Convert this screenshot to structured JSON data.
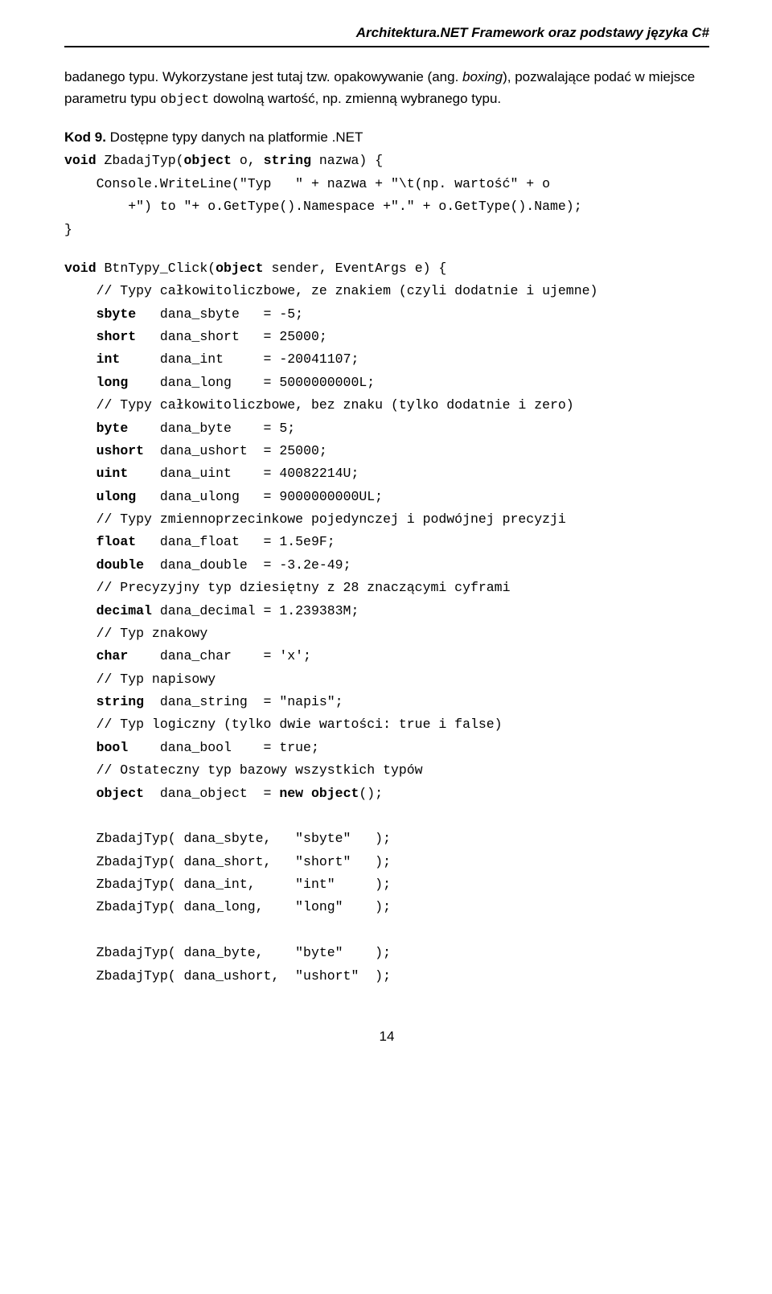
{
  "header": "Architektura.NET Framework oraz podstawy języka C#",
  "para1_a": "badanego typu. Wykorzystane jest tutaj tzw. opakowywanie (ang. ",
  "para1_b": "boxing",
  "para1_c": "), pozwalające podać w miejsce parametru typu ",
  "para1_d": "object",
  "para1_e": " dowolną wartość, np. zmienną wybranego typu.",
  "kod_label_a": "Kod 9.",
  "kod_label_b": " Dostępne typy danych na platformie .NET",
  "lines": {
    "l1a": "void",
    "l1b": " ZbadajTyp(",
    "l1c": "object",
    "l1d": " o, ",
    "l1e": "string",
    "l1f": " nazwa) {",
    "l2": "    Console.WriteLine(\"Typ   \" + nazwa + \"\\t(np. wartość\" + o",
    "l3": "        +\") to \"+ o.GetType().Namespace +\".\" + o.GetType().Name);",
    "l4": "}",
    "l5a": "void",
    "l5b": " BtnTypy_Click(",
    "l5c": "object",
    "l5d": " sender, EventArgs e) {",
    "l6": "    // Typy całkowitoliczbowe, ze znakiem (czyli dodatnie i ujemne)",
    "l7a": "    ",
    "l7b": "sbyte",
    "l7c": "   dana_sbyte   = -5;",
    "l8a": "    ",
    "l8b": "short",
    "l8c": "   dana_short   = 25000;",
    "l9a": "    ",
    "l9b": "int",
    "l9c": "     dana_int     = -20041107;",
    "l10a": "    ",
    "l10b": "long",
    "l10c": "    dana_long    = 5000000000L;",
    "l11": "    // Typy całkowitoliczbowe, bez znaku (tylko dodatnie i zero)",
    "l12a": "    ",
    "l12b": "byte",
    "l12c": "    dana_byte    = 5;",
    "l13a": "    ",
    "l13b": "ushort",
    "l13c": "  dana_ushort  = 25000;",
    "l14a": "    ",
    "l14b": "uint",
    "l14c": "    dana_uint    = 40082214U;",
    "l15a": "    ",
    "l15b": "ulong",
    "l15c": "   dana_ulong   = 9000000000UL;",
    "l16": "    // Typy zmiennoprzecinkowe pojedynczej i podwójnej precyzji",
    "l17a": "    ",
    "l17b": "float",
    "l17c": "   dana_float   = 1.5e9F;",
    "l18a": "    ",
    "l18b": "double",
    "l18c": "  dana_double  = -3.2e-49;",
    "l19": "    // Precyzyjny typ dziesiętny z 28 znaczącymi cyframi",
    "l20a": "    ",
    "l20b": "decimal",
    "l20c": " dana_decimal = 1.239383M;",
    "l21": "    // Typ znakowy",
    "l22a": "    ",
    "l22b": "char",
    "l22c": "    dana_char    = 'x';",
    "l23": "    // Typ napisowy",
    "l24a": "    ",
    "l24b": "string",
    "l24c": "  dana_string  = \"napis\";",
    "l25": "    // Typ logiczny (tylko dwie wartości: true i false)",
    "l26a": "    ",
    "l26b": "bool",
    "l26c": "    dana_bool    = true;",
    "l27": "    // Ostateczny typ bazowy wszystkich typów",
    "l28a": "    ",
    "l28b": "object",
    "l28c": "  dana_object  = ",
    "l28d": "new object",
    "l28e": "();",
    "l29": "    ZbadajTyp( dana_sbyte,   \"sbyte\"   );",
    "l30": "    ZbadajTyp( dana_short,   \"short\"   );",
    "l31": "    ZbadajTyp( dana_int,     \"int\"     );",
    "l32": "    ZbadajTyp( dana_long,    \"long\"    );",
    "l33": "    ZbadajTyp( dana_byte,    \"byte\"    );",
    "l34": "    ZbadajTyp( dana_ushort,  \"ushort\"  );"
  },
  "page_number": "14"
}
